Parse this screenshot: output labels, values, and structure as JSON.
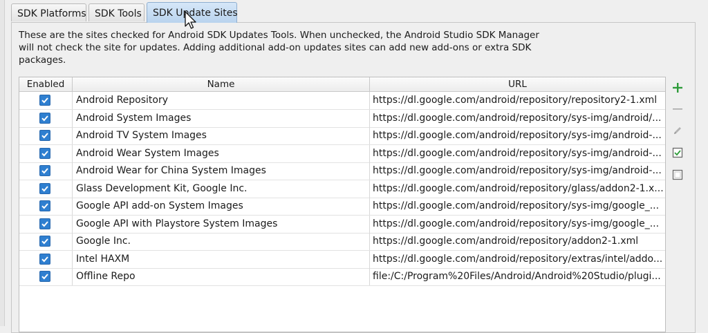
{
  "tabs": [
    {
      "label": "SDK Platforms",
      "active": false
    },
    {
      "label": "SDK Tools",
      "active": false
    },
    {
      "label": "SDK Update Sites",
      "active": true
    }
  ],
  "description": "These are the sites checked for Android SDK Updates Tools. When unchecked, the Android Studio SDK Manager will not check the site for updates. Adding additional add-on updates sites can add new add-ons or extra SDK packages.",
  "table": {
    "headers": {
      "enabled": "Enabled",
      "name": "Name",
      "url": "URL"
    },
    "rows": [
      {
        "enabled": true,
        "name": "Android Repository",
        "url": "https://dl.google.com/android/repository/repository2-1.xml"
      },
      {
        "enabled": true,
        "name": "Android System Images",
        "url": "https://dl.google.com/android/repository/sys-img/android/..."
      },
      {
        "enabled": true,
        "name": "Android TV System Images",
        "url": "https://dl.google.com/android/repository/sys-img/android-..."
      },
      {
        "enabled": true,
        "name": "Android Wear System Images",
        "url": "https://dl.google.com/android/repository/sys-img/android-..."
      },
      {
        "enabled": true,
        "name": "Android Wear for China System Images",
        "url": "https://dl.google.com/android/repository/sys-img/android-..."
      },
      {
        "enabled": true,
        "name": "Glass Development Kit, Google Inc.",
        "url": "https://dl.google.com/android/repository/glass/addon2-1.x..."
      },
      {
        "enabled": true,
        "name": "Google API add-on System Images",
        "url": "https://dl.google.com/android/repository/sys-img/google_..."
      },
      {
        "enabled": true,
        "name": "Google API with Playstore System Images",
        "url": "https://dl.google.com/android/repository/sys-img/google_..."
      },
      {
        "enabled": true,
        "name": "Google Inc.",
        "url": "https://dl.google.com/android/repository/addon2-1.xml"
      },
      {
        "enabled": true,
        "name": "Intel HAXM",
        "url": "https://dl.google.com/android/repository/extras/intel/addo..."
      },
      {
        "enabled": true,
        "name": "Offline Repo",
        "url": "file:/C:/Program%20Files/Android/Android%20Studio/plugi..."
      }
    ]
  },
  "toolbar": {
    "add_icon": "plus-icon",
    "remove_icon": "minus-icon",
    "edit_icon": "pencil-icon",
    "select_all_icon": "checked-box-icon",
    "deselect_all_icon": "unchecked-box-icon"
  },
  "colors": {
    "checkbox": "#2f7fd0",
    "active_tab": "#c6dcf3",
    "add_icon": "#2e9b3a"
  }
}
